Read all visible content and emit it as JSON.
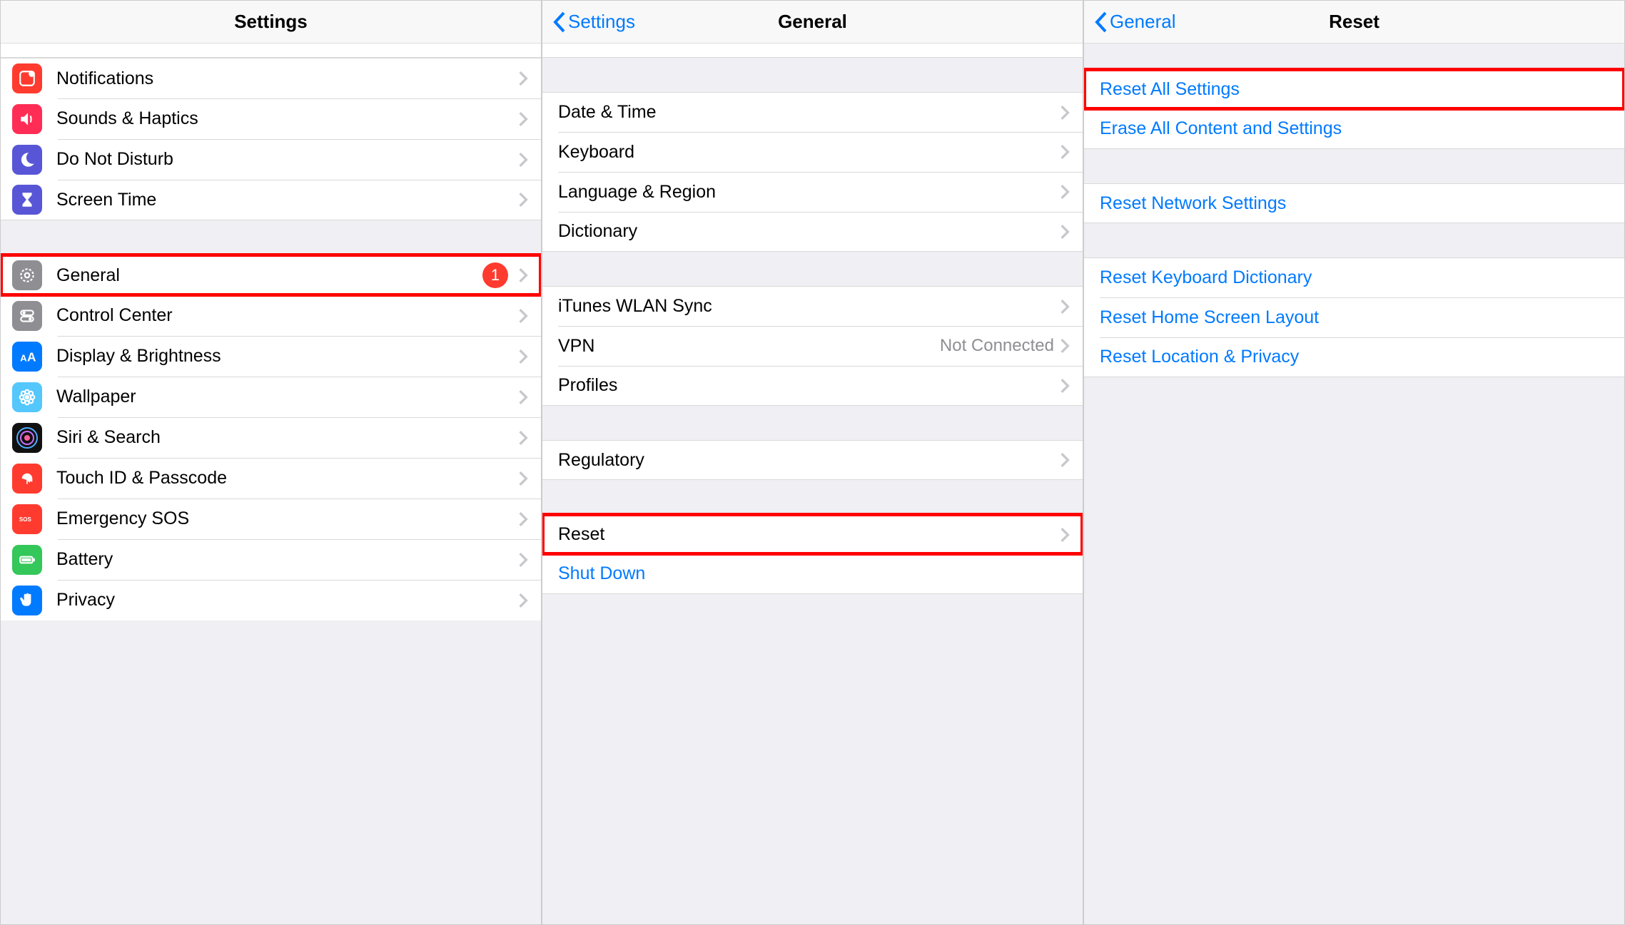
{
  "colors": {
    "ios_blue": "#007aff",
    "highlight_red": "#ff0000",
    "badge_red": "#ff3b30"
  },
  "panel1": {
    "title": "Settings",
    "groupA": [
      {
        "id": "notifications",
        "label": "Notifications",
        "icon": "notifications",
        "bg": "#ff3b30"
      },
      {
        "id": "sounds",
        "label": "Sounds & Haptics",
        "icon": "speaker",
        "bg": "#ff2d55"
      },
      {
        "id": "dnd",
        "label": "Do Not Disturb",
        "icon": "moon",
        "bg": "#5856d6"
      },
      {
        "id": "screentime",
        "label": "Screen Time",
        "icon": "hourglass",
        "bg": "#5856d6"
      }
    ],
    "groupB": [
      {
        "id": "general",
        "label": "General",
        "icon": "gear",
        "bg": "#8e8e93",
        "badge": "1",
        "highlight": true
      },
      {
        "id": "controlcenter",
        "label": "Control Center",
        "icon": "toggles",
        "bg": "#8e8e93"
      },
      {
        "id": "display",
        "label": "Display & Brightness",
        "icon": "aa",
        "bg": "#007aff"
      },
      {
        "id": "wallpaper",
        "label": "Wallpaper",
        "icon": "flower",
        "bg": "#54c7fc"
      },
      {
        "id": "siri",
        "label": "Siri & Search",
        "icon": "siri",
        "bg": "#111"
      },
      {
        "id": "touchid",
        "label": "Touch ID & Passcode",
        "icon": "fingerprint",
        "bg": "#ff3b30"
      },
      {
        "id": "sos",
        "label": "Emergency SOS",
        "icon": "sos",
        "bg": "#ff3b30"
      },
      {
        "id": "battery",
        "label": "Battery",
        "icon": "battery",
        "bg": "#34c759"
      },
      {
        "id": "privacy",
        "label": "Privacy",
        "icon": "hand",
        "bg": "#007aff"
      }
    ]
  },
  "panel2": {
    "back": "Settings",
    "title": "General",
    "groupA": [
      {
        "id": "datetime",
        "label": "Date & Time"
      },
      {
        "id": "keyboard",
        "label": "Keyboard"
      },
      {
        "id": "language",
        "label": "Language & Region"
      },
      {
        "id": "dictionary",
        "label": "Dictionary"
      }
    ],
    "groupB": [
      {
        "id": "itunessync",
        "label": "iTunes WLAN Sync"
      },
      {
        "id": "vpn",
        "label": "VPN",
        "detail": "Not Connected"
      },
      {
        "id": "profiles",
        "label": "Profiles"
      }
    ],
    "groupC": [
      {
        "id": "regulatory",
        "label": "Regulatory"
      }
    ],
    "groupD": [
      {
        "id": "reset",
        "label": "Reset",
        "highlight": true
      },
      {
        "id": "shutdown",
        "label": "Shut Down",
        "link": true,
        "no_chevron": true
      }
    ]
  },
  "panel3": {
    "back": "General",
    "title": "Reset",
    "groupA": [
      {
        "id": "resetall",
        "label": "Reset All Settings",
        "highlight": true
      },
      {
        "id": "eraseall",
        "label": "Erase All Content and Settings"
      }
    ],
    "groupB": [
      {
        "id": "resetnetwork",
        "label": "Reset Network Settings"
      }
    ],
    "groupC": [
      {
        "id": "resetkeyboard",
        "label": "Reset Keyboard Dictionary"
      },
      {
        "id": "resethome",
        "label": "Reset Home Screen Layout"
      },
      {
        "id": "resetlocation",
        "label": "Reset Location & Privacy"
      }
    ]
  }
}
